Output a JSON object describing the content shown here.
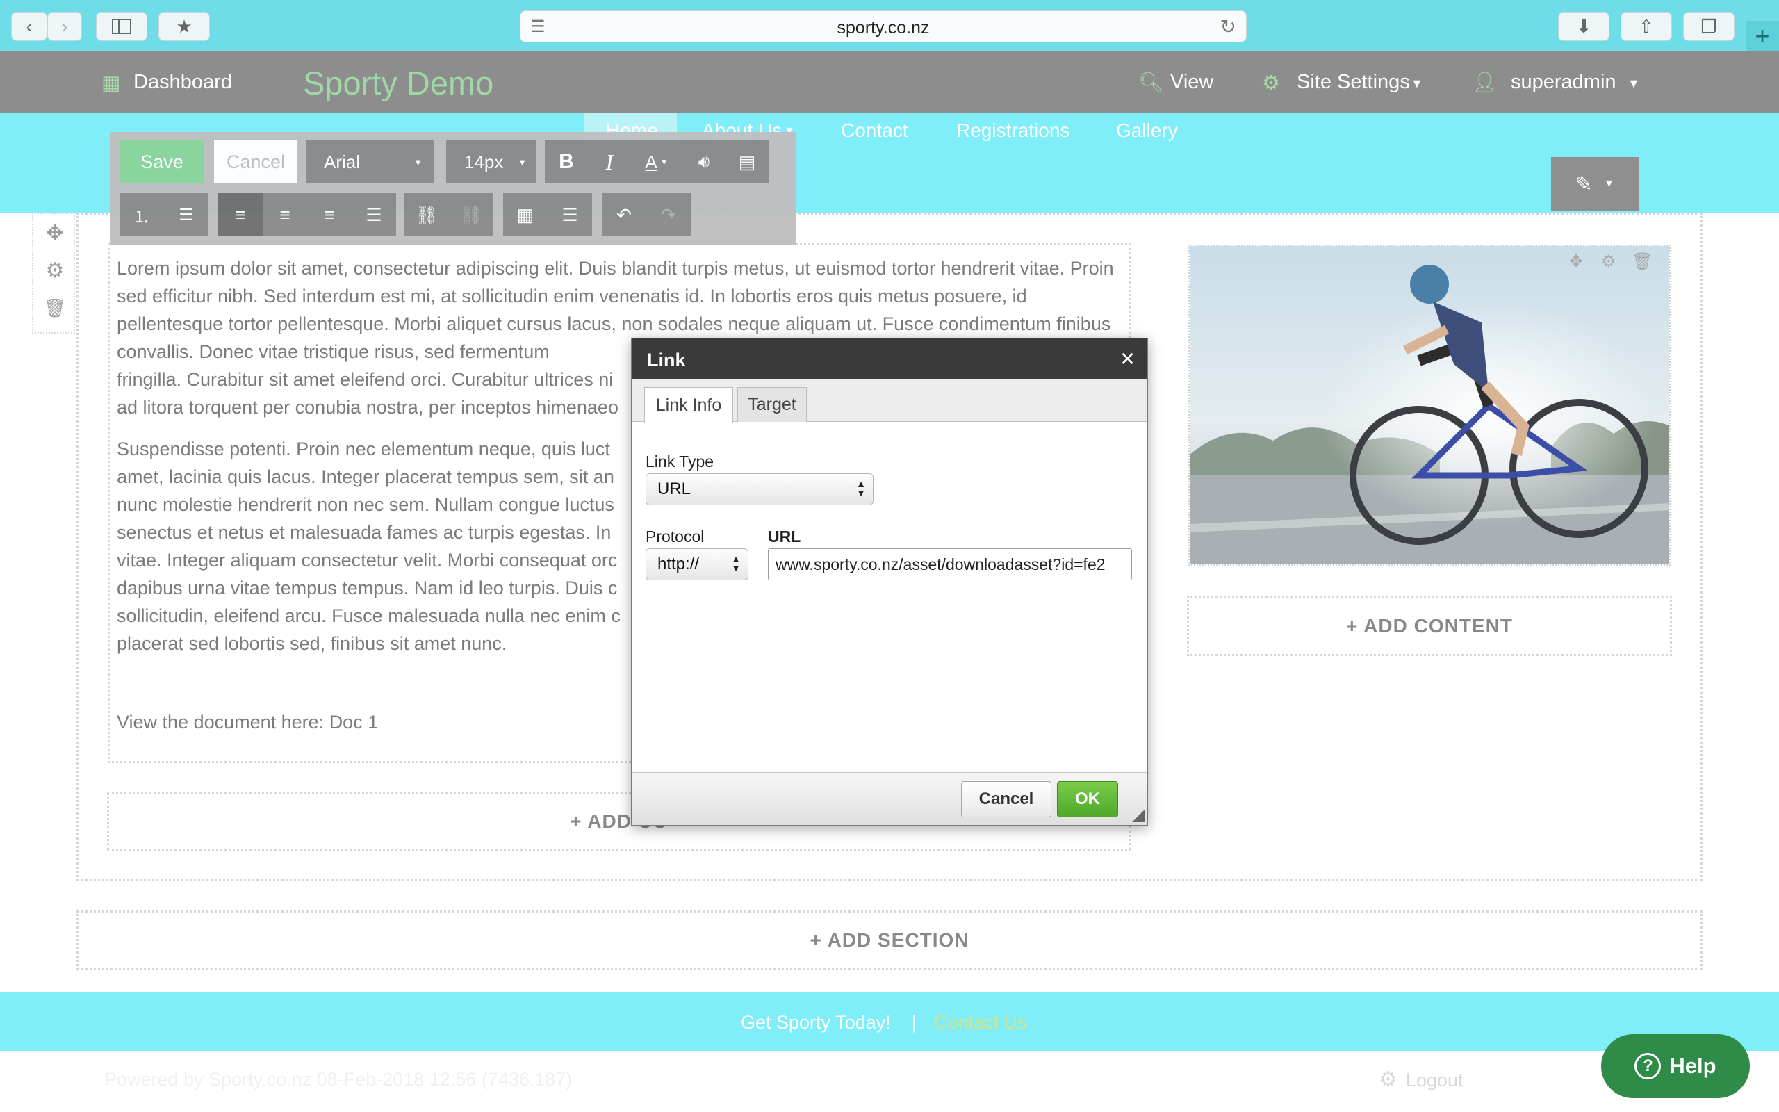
{
  "browser": {
    "address": "sporty.co.nz"
  },
  "admin": {
    "dashboard": "Dashboard",
    "site_title": "Sporty Demo",
    "view": "View",
    "site_settings": "Site Settings",
    "user": "superadmin"
  },
  "nav": {
    "items": [
      "Home",
      "About Us",
      "Contact",
      "Registrations",
      "Gallery"
    ]
  },
  "toolbar": {
    "save": "Save",
    "cancel": "Cancel",
    "font": "Arial",
    "size": "14px"
  },
  "content": {
    "para1": "Lorem ipsum dolor sit amet, consectetur adipiscing elit. Duis blandit turpis metus, ut euismod tortor hendrerit vitae. Proin sed efficitur nibh. Sed interdum est mi, at sollicitudin enim venenatis id. In lobortis eros quis metus posuere, id pellentesque tortor pellentesque. Morbi aliquet cursus lacus, non sodales neque aliquam ut. Fusce condimentum finibus convallis. Donec vitae tristique risus, sed fermentum",
    "para1b": "fringilla. Curabitur sit amet eleifend orci. Curabitur ultrices ni",
    "para1c": "ad litora torquent per conubia nostra, per inceptos himenaeo",
    "para2": [
      "Suspendisse potenti. Proin nec elementum neque, quis luct",
      "amet, lacinia quis lacus. Integer placerat tempus sem, sit an",
      "nunc molestie hendrerit non nec sem. Nullam congue luctus",
      "senectus et netus et malesuada fames ac turpis egestas. In",
      "vitae. Integer aliquam consectetur velit. Morbi consequat orc",
      "dapibus urna vitae tempus tempus. Nam id leo turpis. Duis c",
      "sollicitudin, eleifend arcu. Fusce malesuada nulla nec enim c",
      "placerat sed lobortis sed, finibus sit amet nunc."
    ],
    "doc_line": "View the document here: Doc 1",
    "add_content": "+ ADD CONTENT",
    "add_content_left": "+ ADD CO",
    "add_section": "+  ADD SECTION"
  },
  "footer": {
    "get_sporty": "Get Sporty Today!",
    "separator": "|",
    "contact": "Contact Us",
    "powered": "Powered by Sporty.co.nz 08-Feb-2018 12:56 (7436.187)",
    "logout": "Logout",
    "help": "Help"
  },
  "dialog": {
    "title": "Link",
    "close": "×",
    "tabs": [
      "Link Info",
      "Target"
    ],
    "link_type_label": "Link Type",
    "link_type_value": "URL",
    "protocol_label": "Protocol",
    "protocol_value": "http://",
    "url_label": "URL",
    "url_value": "www.sporty.co.nz/asset/downloadasset?id=fe2",
    "cancel": "Cancel",
    "ok": "OK"
  },
  "colors": {
    "cyan": "#80eef8",
    "admin_gray": "#8d8d8d",
    "ok_green": "#5cb82e",
    "help_green": "#2f8c48"
  }
}
